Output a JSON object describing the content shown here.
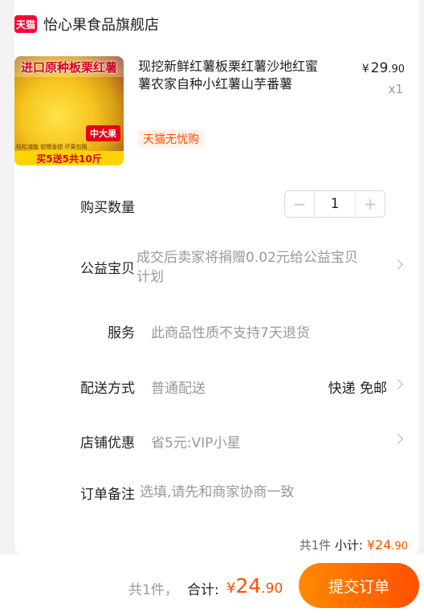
{
  "shop": {
    "logo_text": "天猫",
    "name": "怡心果食品旗舰店"
  },
  "product": {
    "image": {
      "banner": "进口原种板栗红薯",
      "badge": "中大果",
      "small_text": "轻松减脂  软糯香甜  坏果包赔",
      "promo": "买5送5共10斤"
    },
    "title": "现挖新鲜红薯板栗红薯沙地红蜜薯农家自种小红薯山芋番薯",
    "price_symbol": "¥",
    "price_int": "29",
    "price_cents": ".90",
    "quantity_text": "x1",
    "tag": "天猫无忧购"
  },
  "rows": {
    "quantity": {
      "label": "购买数量",
      "minus": "−",
      "value": "1",
      "plus": "+"
    },
    "charity": {
      "label": "公益宝贝",
      "value": "成交后卖家将捐赠0.02元给公益宝贝计划"
    },
    "service": {
      "label": "服务",
      "value": "此商品性质不支持7天退货"
    },
    "delivery": {
      "label": "配送方式",
      "value": "普通配送",
      "right": "快递 免邮"
    },
    "discount": {
      "label": "店铺优惠",
      "value": "省5元:VIP小星"
    },
    "remark": {
      "label": "订单备注",
      "placeholder": "选填,请先和商家协商一致"
    }
  },
  "subtotal": {
    "count": "共1件",
    "label": "小计:",
    "symbol": "¥",
    "int": "24",
    "cents": ".90"
  },
  "footer": {
    "count": "共1件，",
    "label": "合计:",
    "symbol": "¥",
    "int": "24",
    "cents": ".90",
    "submit_label": "提交订单"
  },
  "colors": {
    "accent": "#ff5000",
    "tmall_red": "#ff0036"
  }
}
